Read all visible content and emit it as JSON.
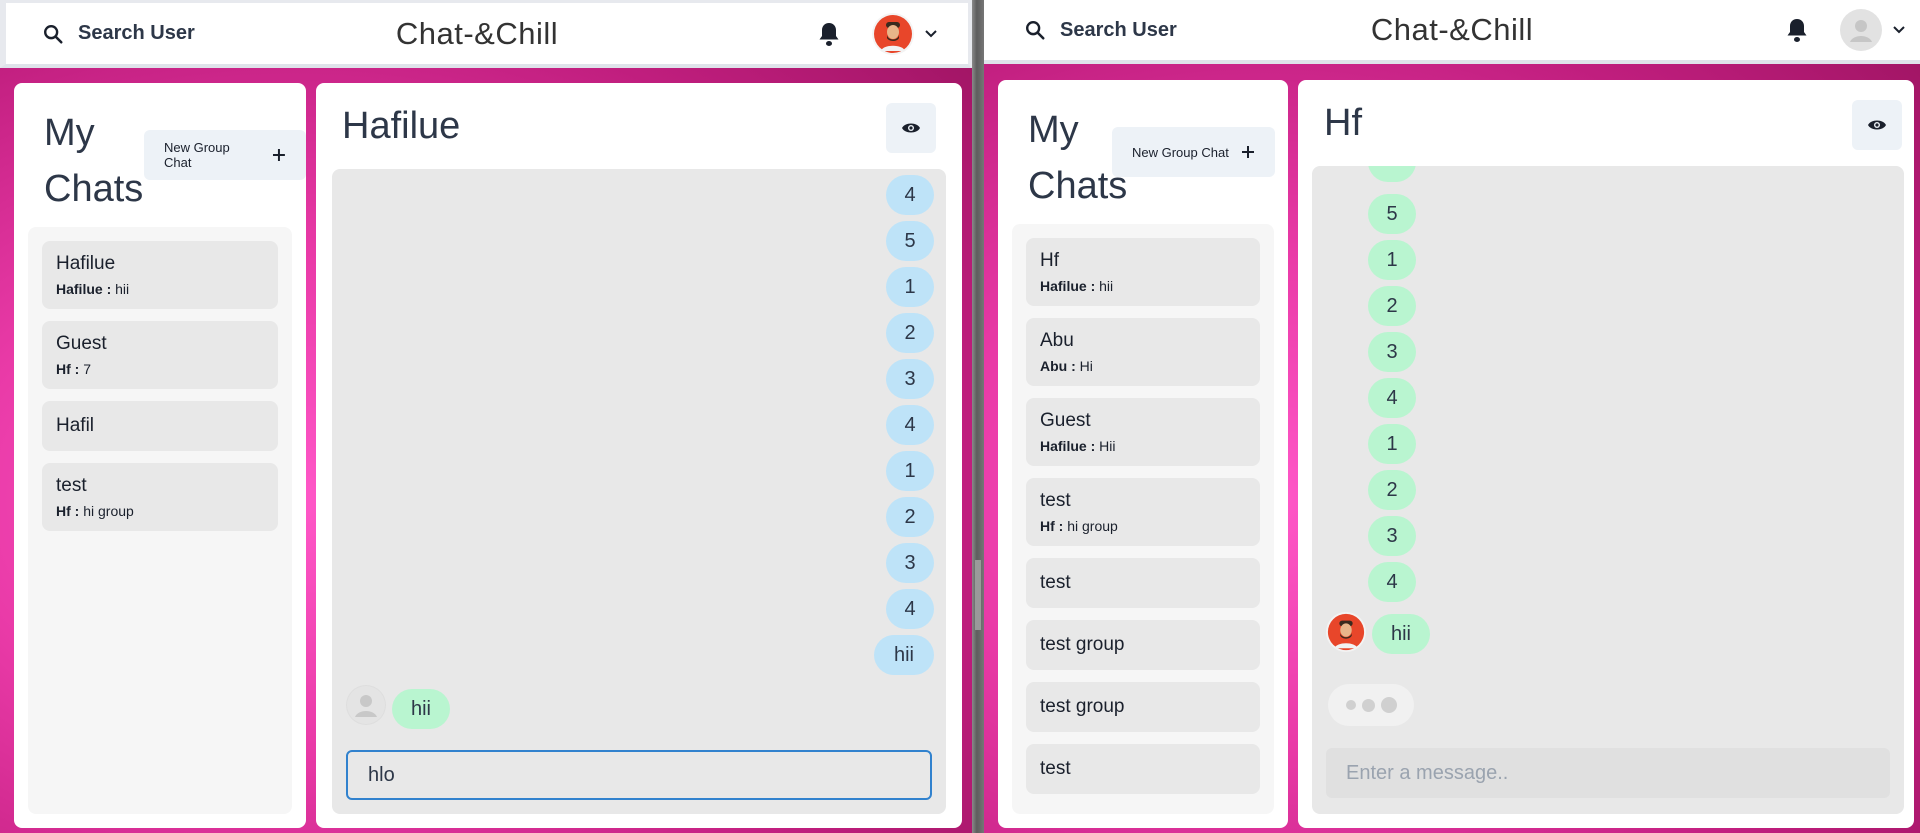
{
  "left": {
    "header": {
      "search_label": "Search User",
      "app_title": "Chat-&Chill",
      "avatar_icon": "user-photo-avatar",
      "bell_icon": "bell-icon"
    },
    "my_chats": {
      "title": "My Chats",
      "new_group_label": "New Group Chat",
      "items": [
        {
          "name": "Hafilue",
          "sender": "Hafilue :",
          "text": "hii"
        },
        {
          "name": "Guest",
          "sender": "Hf :",
          "text": "7"
        },
        {
          "name": "Hafil",
          "sender": "",
          "text": ""
        },
        {
          "name": "test",
          "sender": "Hf :",
          "text": "hi group"
        }
      ]
    },
    "chat": {
      "title": "Hafilue",
      "sent_messages": [
        "4",
        "5",
        "1",
        "2",
        "3",
        "4",
        "1",
        "2",
        "3",
        "4",
        "hii"
      ],
      "received_message": "hii",
      "input_value": "hlo"
    }
  },
  "right": {
    "header": {
      "search_label": "Search User",
      "app_title": "Chat-&Chill",
      "avatar_icon": "default-user-avatar",
      "bell_icon": "bell-icon"
    },
    "my_chats": {
      "title": "My Chats",
      "new_group_label": "New Group Chat",
      "items": [
        {
          "name": "Hf",
          "sender": "Hafilue :",
          "text": "hii"
        },
        {
          "name": "Abu",
          "sender": "Abu :",
          "text": "Hi"
        },
        {
          "name": "Guest",
          "sender": "Hafilue :",
          "text": "Hii"
        },
        {
          "name": "test",
          "sender": "Hf :",
          "text": "hi group"
        },
        {
          "name": "test",
          "sender": "",
          "text": ""
        },
        {
          "name": "test group",
          "sender": "",
          "text": ""
        },
        {
          "name": "test group",
          "sender": "",
          "text": ""
        },
        {
          "name": "test",
          "sender": "",
          "text": ""
        }
      ]
    },
    "chat": {
      "title": "Hf",
      "received_messages": [
        "5",
        "1",
        "2",
        "3",
        "4",
        "1",
        "2",
        "3",
        "4"
      ],
      "last_message": "hii",
      "input_placeholder": "Enter a message.."
    }
  },
  "colors": {
    "sent_bubble": "#bee3f8",
    "received_bubble": "#b9f5d0",
    "background_accent": "#e93aa7"
  }
}
